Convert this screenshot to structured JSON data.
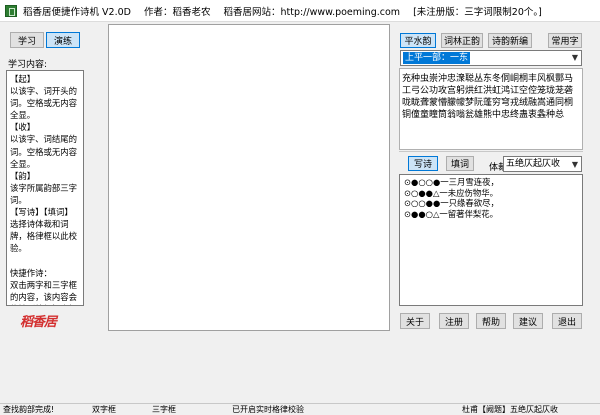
{
  "window": {
    "app_title": "稻香居便捷作诗机 V2.0D",
    "author": "作者：稻香老农",
    "site": "稻香居网站：http://www.poeming.com",
    "trial_note": "[未注册版：三字词限制20个。]"
  },
  "left": {
    "tab_study": "学习",
    "tab_practice": "演练",
    "content_label": "学习内容:",
    "study_text": "【起】\n以该字、词开头的词。空格或无内容全显。\n【收】\n以该字、词结尾的词。空格或无内容全显。\n【韵】\n该字所属韵部三字词。\n【写诗】【填词】\n选择诗体裁和词牌，格律框以此校验。\n\n快捷作诗：\n双击两字和三字框的内容，该内容会传输到编辑框光标所在位置。在选好韵部的情况下，可以快速通过双击两字或三字框拼出一首诗。\n\n双击韵字或常用字框可快速选择字。",
    "seal_text": "稻香居"
  },
  "right": {
    "tab_pingshui": "平水韵",
    "tab_cilin": "词林正韵",
    "tab_shiyun": "诗韵新编",
    "btn_common": "常用字",
    "tone_value": "上平一部：一东",
    "rhyme_chars": "充种虫崇沖忠潨聪丛东冬侗峒桐丰风枫酆马工弓公功攻宫躬烘红洪虹鸿讧空倥笼珑茏砻咙眬聋蒙懵朦幪梦阮蓬穷穹戎绒融嵩通同桐铜僮童瞳筒翁嗡瓮雄熊中忠终蛊衷螽种总",
    "mode_poem": "写诗",
    "mode_ci": "填词",
    "form_label": "体裁",
    "form_value": "五绝仄起仄收",
    "pattern_lines": [
      "⊙●○○●一三月雪连夜，",
      "⊙○●●△一未应伤物华。",
      "⊙○○●●一只缘春欲尽，",
      "⊙●●○△一留著伴梨花。"
    ],
    "btn_about": "关于",
    "btn_register": "注册",
    "btn_help": "帮助",
    "btn_suggest": "建议",
    "btn_exit": "退出"
  },
  "status": {
    "s1": "查找韵部完成!",
    "s2": "双字框",
    "s3": "三字框",
    "s4": "已开启实时格律校验",
    "s5": "杜甫【阙题】五绝仄起仄收"
  }
}
